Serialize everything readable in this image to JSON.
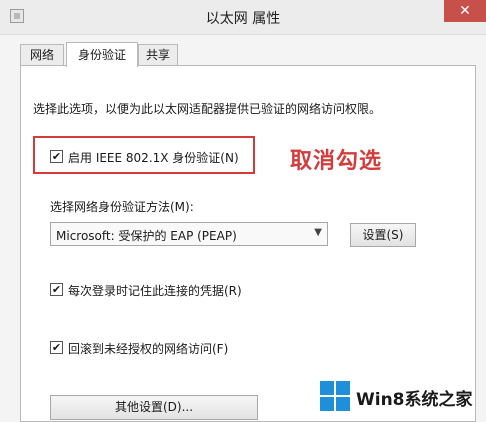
{
  "window": {
    "title": "以太网 属性",
    "close_label": "✕"
  },
  "tabs": [
    {
      "label": "网络",
      "active": false
    },
    {
      "label": "身份验证",
      "active": true
    },
    {
      "label": "共享",
      "active": false
    }
  ],
  "auth": {
    "description": "选择此选项，以便为此以太网适配器提供已验证的网络访问权限。",
    "enable_8021x": {
      "label": "启用 IEEE 802.1X 身份验证(N)",
      "checked": true,
      "check_glyph": "✔"
    },
    "annotation": "取消勾选",
    "method_label": "选择网络身份验证方法(M):",
    "method_value": "Microsoft: 受保护的 EAP (PEAP)",
    "settings_button": "设置(S)",
    "remember_credentials": {
      "label": "每次登录时记住此连接的凭据(R)",
      "checked": true,
      "check_glyph": "✔"
    },
    "fallback": {
      "label": "回滚到未经授权的网络访问(F)",
      "checked": true,
      "check_glyph": "✔"
    },
    "other_settings_button": "其他设置(D)..."
  },
  "watermark": {
    "text": "Win8系统之家"
  },
  "colors": {
    "annotation": "#d43c3c",
    "close_button": "#c7504b",
    "win_logo": "#1e8fd8"
  }
}
